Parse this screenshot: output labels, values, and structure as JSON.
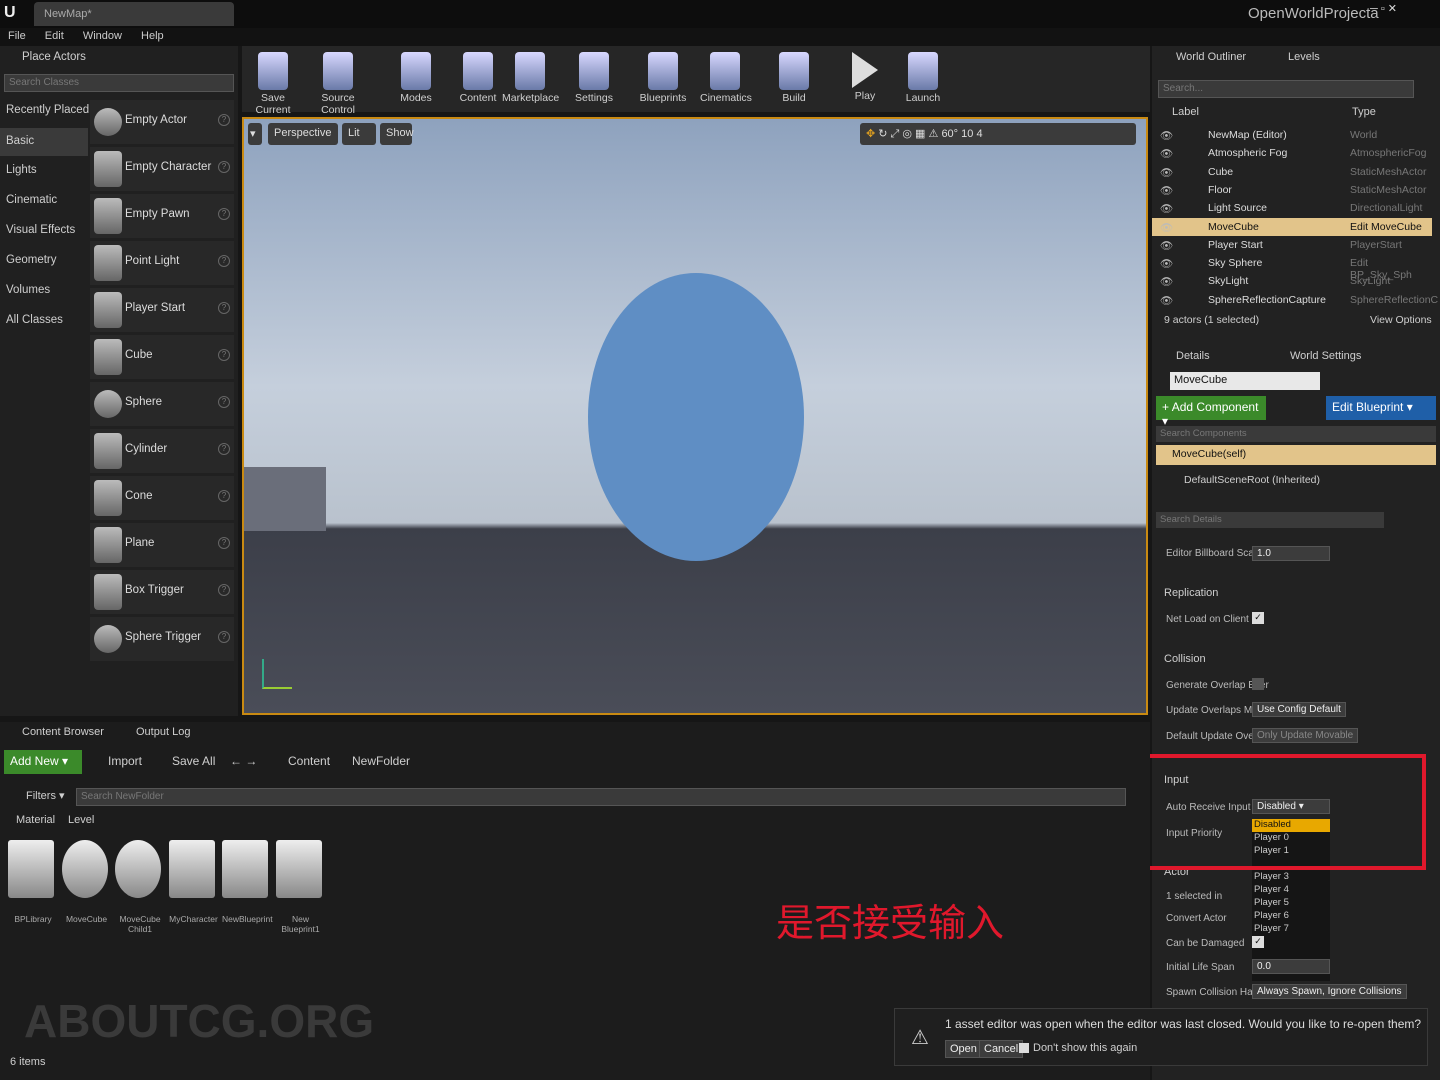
{
  "titlebar": {
    "tab": "NewMap*",
    "project": "OpenWorldProjecta"
  },
  "menu": [
    "File",
    "Edit",
    "Window",
    "Help"
  ],
  "place": {
    "title": "Place Actors",
    "search_placeholder": "Search Classes",
    "categories": [
      "Recently Placed",
      "Basic",
      "Lights",
      "Cinematic",
      "Visual Effects",
      "Geometry",
      "Volumes",
      "All Classes"
    ],
    "items": [
      "Empty Actor",
      "Empty Character",
      "Empty Pawn",
      "Point Light",
      "Player Start",
      "Cube",
      "Sphere",
      "Cylinder",
      "Cone",
      "Plane",
      "Box Trigger",
      "Sphere Trigger"
    ]
  },
  "toolbar": [
    "Save Current",
    "Source Control",
    "Modes",
    "Content",
    "Marketplace",
    "Settings",
    "Blueprints",
    "Cinematics",
    "Build",
    "Play",
    "Launch"
  ],
  "viewport": {
    "perspective": "Perspective",
    "lit": "Lit",
    "show": "Show",
    "fov": "60°",
    "snap": "10",
    "cam": "4"
  },
  "outliner": {
    "tab1": "World Outliner",
    "tab2": "Levels",
    "search": "Search...",
    "col_label": "Label",
    "col_type": "Type",
    "rows": [
      {
        "n": "NewMap (Editor)",
        "t": "World"
      },
      {
        "n": "Atmospheric Fog",
        "t": "AtmosphericFog"
      },
      {
        "n": "Cube",
        "t": "StaticMeshActor"
      },
      {
        "n": "Floor",
        "t": "StaticMeshActor"
      },
      {
        "n": "Light Source",
        "t": "DirectionalLight"
      },
      {
        "n": "MoveCube",
        "t": "Edit MoveCube"
      },
      {
        "n": "Player Start",
        "t": "PlayerStart"
      },
      {
        "n": "Sky Sphere",
        "t": "Edit BP_Sky_Sph"
      },
      {
        "n": "SkyLight",
        "t": "SkyLight"
      },
      {
        "n": "SphereReflectionCapture",
        "t": "SphereReflectionC"
      }
    ],
    "status": "9 actors (1 selected)",
    "view_options": "View Options"
  },
  "details": {
    "tab1": "Details",
    "tab2": "World Settings",
    "name": "MoveCube",
    "add": "Add Component",
    "edit": "Edit Blueprint",
    "search_comp": "Search Components",
    "self": "MoveCube(self)",
    "root": "DefaultSceneRoot (Inherited)",
    "search_details": "Search Details",
    "billboard_label": "Editor Billboard Scale",
    "billboard_val": "1.0",
    "replication": "Replication",
    "net_load": "Net Load on Client",
    "collision": "Collision",
    "gen_overlap": "Generate Overlap Ever",
    "upd_overlap": "Update Overlaps Meth",
    "upd_overlap_val": "Use Config Default",
    "def_upd": "Default Update Overla",
    "def_upd_val": "Only Update Movable",
    "input": "Input",
    "auto_receive": "Auto Receive Input",
    "auto_receive_val": "Disabled",
    "input_priority": "Input Priority",
    "options": [
      "Disabled",
      "Player 0",
      "Player 1",
      "Player 3",
      "Player 4",
      "Player 5",
      "Player 6",
      "Player 7"
    ],
    "actor": "Actor",
    "selected_in": "1 selected in",
    "convert": "Convert Actor",
    "damaged": "Can be Damaged",
    "lifespan": "Initial Life Span",
    "lifespan_val": "0.0",
    "spawn": "Spawn Collision Handl",
    "spawn_val": "Always Spawn, Ignore Collisions"
  },
  "content": {
    "tab1": "Content Browser",
    "tab2": "Output Log",
    "add_new": "Add New",
    "import": "Import",
    "save_all": "Save All",
    "path1": "Content",
    "path2": "NewFolder",
    "filters": "Filters",
    "search": "Search NewFolder",
    "filter_tags": [
      "Material",
      "Level"
    ],
    "assets": [
      "BPLibrary",
      "MoveCube",
      "MoveCube Child1",
      "MyCharacter",
      "NewBlueprint",
      "New Blueprint1"
    ],
    "count": "6 items"
  },
  "annotation": "是否接受输入",
  "watermark": "ABOUTCG.ORG",
  "notice": {
    "text": "1 asset editor was open when the editor was last closed. Would you like to re-open them?",
    "open": "Open",
    "cancel": "Cancel",
    "dont_show": "Don't show this again"
  }
}
